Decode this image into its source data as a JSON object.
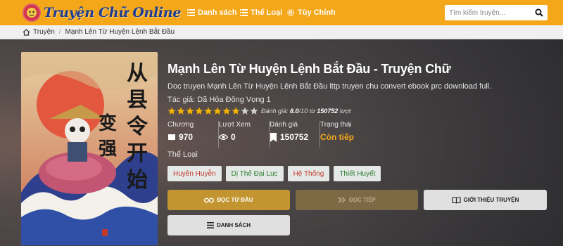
{
  "header": {
    "logo_text": "Truyện Chữ Online",
    "nav": [
      {
        "label": "Danh sách",
        "icon": "list-icon"
      },
      {
        "label": "Thể Loại",
        "icon": "category-list-icon"
      },
      {
        "label": "Tùy Chỉnh",
        "icon": "gear-icon"
      }
    ],
    "search_placeholder": "Tìm kiếm truyện...",
    "colors": {
      "bar": "#f5a71a",
      "logo": "#1d3d8f"
    }
  },
  "breadcrumb": {
    "home": "Truyện",
    "current": "Mạnh Lên Từ Huyện Lệnh Bắt Đầu"
  },
  "novel": {
    "title": "Mạnh Lên Từ Huyện Lệnh Bắt Đầu - Truyện Chữ",
    "description": "Doc truyen Mạnh Lên Từ Huyện Lệnh Bắt Đầu lttp truyen chu convert ebook prc download full.",
    "author_label": "Tác giả:",
    "author": "Dã Hỏa Đông Vọng 1",
    "rating": {
      "stars_filled": 8,
      "stars_total": 10,
      "prefix": "Đánh giá:",
      "score": "8.0",
      "out_of": "/10 từ",
      "count": "150752",
      "suffix": "lượt"
    },
    "stats": [
      {
        "label": "Chương",
        "value": "970",
        "icon": "book-icon"
      },
      {
        "label": "Lượt Xem",
        "value": "0",
        "icon": "eye-icon"
      },
      {
        "label": "Đánh giá",
        "value": "150752",
        "icon": "bookmark-icon"
      },
      {
        "label": "Trạng thái",
        "value": "Còn tiếp",
        "icon": ""
      }
    ],
    "genre_label": "Thể Loại",
    "genres": [
      {
        "label": "Huyền Huyễn",
        "color": "#c0392b"
      },
      {
        "label": "Dị Thế Đại Lục",
        "color": "#2e7d32"
      },
      {
        "label": "Hệ Thống",
        "color": "#c0392b"
      },
      {
        "label": "Thiết Huyết",
        "color": "#2e7d32"
      }
    ]
  },
  "actions": {
    "read_from_start": "ĐỌC TỪ ĐẦU",
    "continue_reading": "ĐỌC TIẾP",
    "introduction": "GIỚI THIỆU TRUYỆN",
    "chapter_list": "DANH SÁCH"
  }
}
